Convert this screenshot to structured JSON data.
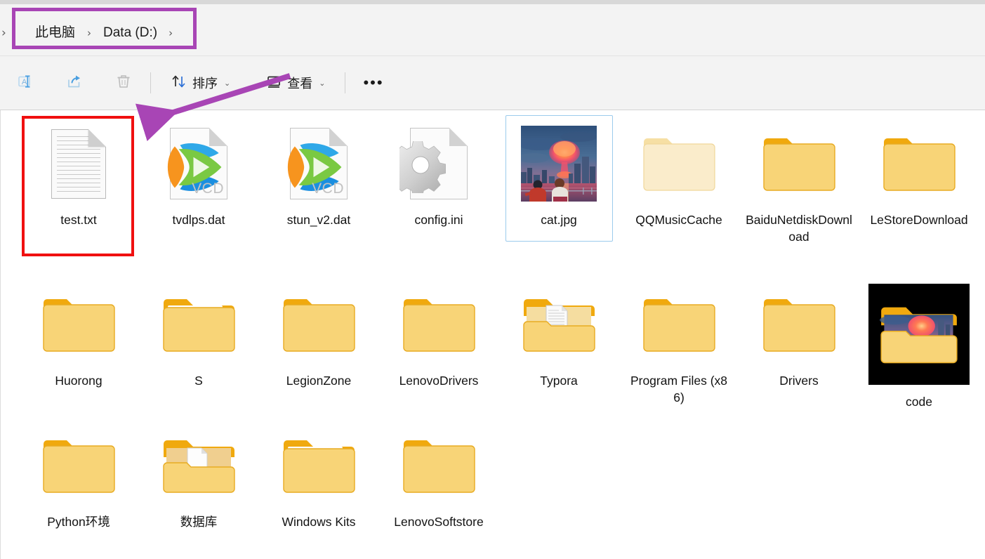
{
  "window": {
    "breadcrumb": {
      "left_chevron": "›",
      "items": [
        "此电脑",
        "Data (D:)"
      ],
      "separator": "›",
      "tail_separator": "›"
    }
  },
  "toolbar": {
    "buttons": [
      {
        "name": "rename",
        "icon": "rename-icon",
        "label": ""
      },
      {
        "name": "share",
        "icon": "share-icon",
        "label": ""
      },
      {
        "name": "delete",
        "icon": "trash-icon",
        "label": ""
      },
      {
        "name": "sort",
        "icon": "sort-icon",
        "label": "排序",
        "caret": "⌄"
      },
      {
        "name": "view",
        "icon": "view-icon",
        "label": "查看",
        "caret": "⌄"
      },
      {
        "name": "more",
        "icon": "more-icon",
        "label": "•••"
      }
    ],
    "sort_label": "排序",
    "view_label": "查看",
    "caret": "⌄",
    "more_label": "•••"
  },
  "files": {
    "rows": [
      [
        {
          "name": "test.txt",
          "kind": "text-file",
          "selected": false
        },
        {
          "name": "tvdlps.dat",
          "kind": "vcd-file",
          "badge": "VCD"
        },
        {
          "name": "stun_v2.dat",
          "kind": "vcd-file",
          "badge": "VCD"
        },
        {
          "name": "config.ini",
          "kind": "ini-file"
        },
        {
          "name": "cat.jpg",
          "kind": "image-file",
          "selected": true
        },
        {
          "name": "QQMusicCache",
          "kind": "folder-faded"
        },
        {
          "name": "BaiduNetdiskDownload",
          "kind": "folder"
        },
        {
          "name": "LeStoreDownload",
          "kind": "folder"
        }
      ],
      [
        {
          "name": "Huorong",
          "kind": "folder"
        },
        {
          "name": "S",
          "kind": "folder-sheet"
        },
        {
          "name": "LegionZone",
          "kind": "folder"
        },
        {
          "name": "LenovoDrivers",
          "kind": "folder"
        },
        {
          "name": "Typora",
          "kind": "folder-doc"
        },
        {
          "name": "Program Files (x86)",
          "kind": "folder"
        },
        {
          "name": "Drivers",
          "kind": "folder"
        },
        {
          "name": "code",
          "kind": "folder-thumb-black"
        }
      ],
      [
        {
          "name": "Python环境",
          "kind": "folder"
        },
        {
          "name": "数据库",
          "kind": "folder-doc"
        },
        {
          "name": "Windows Kits",
          "kind": "folder-sheet"
        },
        {
          "name": "LenovoSoftstore",
          "kind": "folder"
        }
      ]
    ]
  },
  "annotations": {
    "highlight_breadcrumb": {
      "color": "#a845b5"
    },
    "highlight_test_file": {
      "color": "#f01010"
    },
    "arrow": {
      "color": "#a845b5",
      "points_to": "test.txt",
      "from": "查看"
    }
  },
  "colors": {
    "accent_purple": "#a845b5",
    "accent_red": "#f01010",
    "folder_yellow": "#f5c344",
    "folder_tab": "#f0a90e",
    "selection_blue": "#9ccbec",
    "toolbar_bg": "#f3f3f3",
    "content_bg": "#ffffff"
  }
}
